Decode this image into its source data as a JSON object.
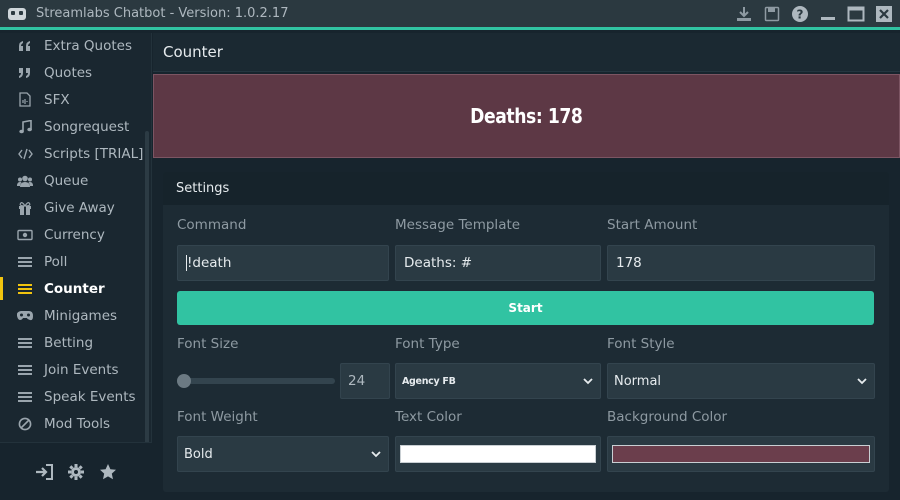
{
  "window": {
    "title": "Streamlabs Chatbot - Version: 1.0.2.17",
    "controls": [
      "download-icon",
      "save-icon",
      "help-icon",
      "minimize-icon",
      "maximize-icon",
      "close-icon"
    ]
  },
  "sidebar": {
    "items": [
      {
        "label": "Extra Quotes",
        "icon": "quote-left-icon"
      },
      {
        "label": "Quotes",
        "icon": "quote-right-icon"
      },
      {
        "label": "SFX",
        "icon": "sfx-file-icon"
      },
      {
        "label": "Songrequest",
        "icon": "music-note-icon"
      },
      {
        "label": "Scripts [TRIAL]",
        "icon": "code-icon"
      },
      {
        "label": "Queue",
        "icon": "users-icon"
      },
      {
        "label": "Give Away",
        "icon": "gift-icon"
      },
      {
        "label": "Currency",
        "icon": "money-icon"
      },
      {
        "label": "Poll",
        "icon": "list-icon"
      },
      {
        "label": "Counter",
        "icon": "list-icon",
        "active": true
      },
      {
        "label": "Minigames",
        "icon": "gamepad-icon"
      },
      {
        "label": "Betting",
        "icon": "list-icon"
      },
      {
        "label": "Join Events",
        "icon": "list-icon"
      },
      {
        "label": "Speak Events",
        "icon": "list-icon"
      },
      {
        "label": "Mod Tools",
        "icon": "ban-icon"
      }
    ],
    "footer": [
      "sign-in-icon",
      "gear-icon",
      "star-icon"
    ],
    "accent_color": "#f1c40f"
  },
  "main": {
    "page_title": "Counter",
    "preview_text": "Deaths: 178",
    "preview_bg": "#5d3845",
    "settings": {
      "title": "Settings",
      "command_label": "Command",
      "command_value": "!death",
      "template_label": "Message Template",
      "template_value": "Deaths: #",
      "start_amount_label": "Start Amount",
      "start_amount_value": "178",
      "start_button": "Start",
      "font_size_label": "Font Size",
      "font_size_value": "24",
      "font_type_label": "Font Type",
      "font_type_value": "Agency FB",
      "font_style_label": "Font Style",
      "font_style_value": "Normal",
      "font_weight_label": "Font Weight",
      "font_weight_value": "Bold",
      "text_color_label": "Text Color",
      "text_color_value": "#ffffff",
      "bg_color_label": "Background Color",
      "bg_color_value": "#6b3e4c"
    },
    "accent_color": "#31c3a2"
  }
}
